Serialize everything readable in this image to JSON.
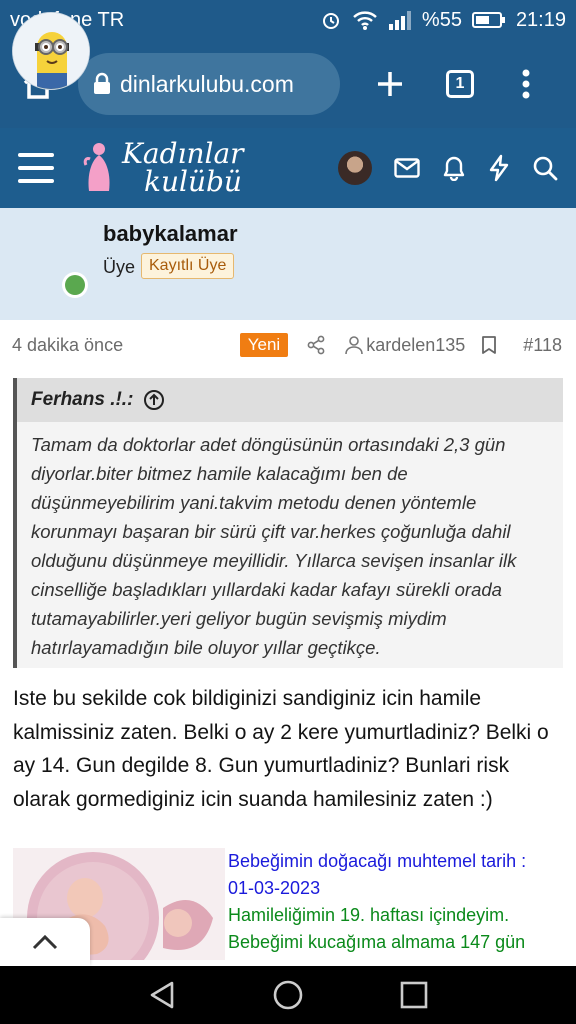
{
  "status_bar": {
    "carrier": "vodafone TR",
    "battery": "%55",
    "time": "21:19"
  },
  "browser": {
    "url": "dinlarkulubu.com",
    "tab_count": "1"
  },
  "site": {
    "logo_line1": "Kadınlar",
    "logo_line2": "kulübü"
  },
  "user": {
    "username": "babykalamar",
    "role": "Üye",
    "badge": "Kayıtlı Üye"
  },
  "post_meta": {
    "time": "4 dakika önce",
    "new_label": "Yeni",
    "author": "kardelen135",
    "post_number": "#118"
  },
  "quote": {
    "author": "Ferhans .!.:",
    "text": "Tamam da doktorlar adet döngüsünün ortasındaki 2,3 gün diyorlar.biter bitmez hamile kalacağımı ben de düşünmeyebilirim yani.takvim metodu denen yöntemle korunmayı başaran bir sürü çift var.herkes çoğunluğa dahil olduğunu düşünmeye meyillidir. Yıllarca sevişen insanlar ilk cinselliğe başladıkları yıllardaki kadar kafayı sürekli orada tutamayabilirler.yeri geliyor bugün sevişmiş miydim hatırlayamadığın bile oluyor yıllar geçtikçe."
  },
  "post_text": "Iste bu sekilde cok bildiginizi sandiginiz icin hamile kalmissiniz zaten. Belki o ay 2 kere yumurtladiniz? Belki o ay 14. Gun degilde 8. Gun yumurtladiniz? Bunlari risk olarak gormediginiz icin suanda hamilesiniz zaten :)",
  "signature": {
    "line1": "Bebeğimin doğacağı muhtemel tarih :",
    "line2": "01-03-2023",
    "line3": "Hamileliğimin 19. haftası içindeyim.",
    "line4": "Bebeğimi kucağıma almama 147 gün"
  },
  "colors": {
    "header_blue": "#1f5a8a",
    "banner": "#dbe8f3",
    "new_badge": "#f07d12",
    "sig_blue": "#1a1adb",
    "sig_green": "#0b8a1b"
  }
}
